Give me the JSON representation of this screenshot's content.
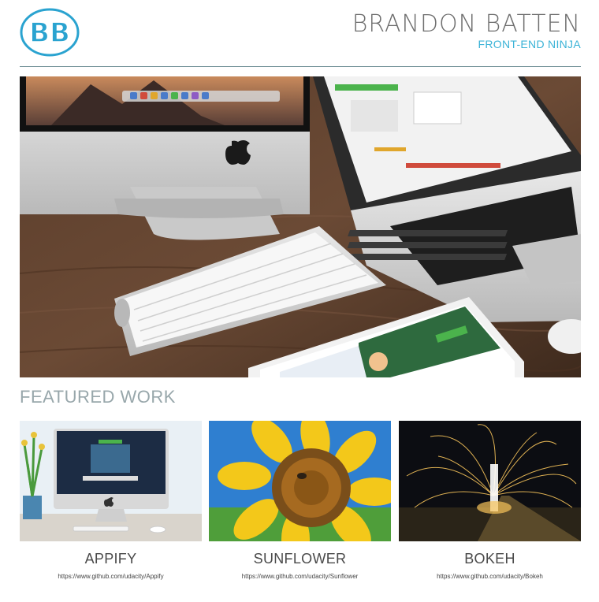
{
  "header": {
    "name": "BRANDON BATTEN",
    "tagline": "FRONT-END NINJA",
    "logo_text": "BB",
    "accent_color": "#3bb3d7"
  },
  "hero": {
    "image": "desk-workspace-photo"
  },
  "featured": {
    "title": "FEATURED WORK",
    "projects": [
      {
        "title": "APPIFY",
        "link": "https://www.github.com/udacity/Appify",
        "image": "imac-desk-photo"
      },
      {
        "title": "SUNFLOWER",
        "link": "https://www.github.com/udacity/Sunflower",
        "image": "sunflower-photo"
      },
      {
        "title": "BOKEH",
        "link": "https://www.github.com/udacity/Bokeh",
        "image": "sparks-photo"
      }
    ]
  }
}
